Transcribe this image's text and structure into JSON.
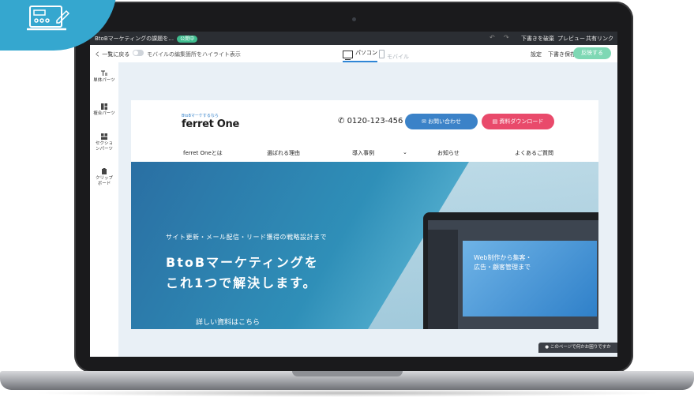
{
  "topbar": {
    "doc_title": "BtoBマーケティングの課題を…",
    "status_badge": "公開中",
    "undo_icon": "↶",
    "redo_icon": "↷",
    "discard_label": "下書きを破棄",
    "preview_label": "プレビュー",
    "share_label": "共有リンク"
  },
  "toolbar": {
    "back_label": "く 一覧に戻る",
    "highlight_toggle_label": "モバイルの編集箇所をハイライト表示",
    "tab_pc_label": "パソコン",
    "tab_mobile_label": "モバイル",
    "settings_label": "設定",
    "save_draft_label": "下書き保存",
    "publish_label": "反映する"
  },
  "sidebar": {
    "items": [
      {
        "label": "単体パーツ",
        "icon": "text-icon"
      },
      {
        "label": "複合パーツ",
        "icon": "blocks-icon"
      },
      {
        "label": "セクションパーツ",
        "icon": "section-icon"
      },
      {
        "label": "クリップボード",
        "icon": "clipboard-icon"
      }
    ]
  },
  "site": {
    "logo_tagline": "BtoBマーケするなら",
    "logo": "ferret One",
    "phone": "0120-123-456",
    "contact_button": "お問い合わせ",
    "download_button": "資料ダウンロード",
    "nav": [
      "ferret Oneとは",
      "選ばれる理由",
      "導入事例",
      "お知らせ",
      "よくあるご質問"
    ],
    "hero_subtitle": "サイト更新・メール配信・リード獲得の戦略設計まで",
    "hero_title_line1": "BtoBマーケティングを",
    "hero_title_line2": "これ1つで解決します。",
    "hero_cta": "詳しい資料はこちら",
    "mini_screen_text_line1": "Web制作から集客・",
    "mini_screen_text_line2": "広告・顧客管理まで"
  },
  "feedback": {
    "label": "このページで何かお困りですか"
  },
  "colors": {
    "accent_blue": "#3b82c8",
    "accent_pink": "#e94a6b",
    "publish_green": "#7ed8b4",
    "corner_badge": "#35a7cf"
  }
}
